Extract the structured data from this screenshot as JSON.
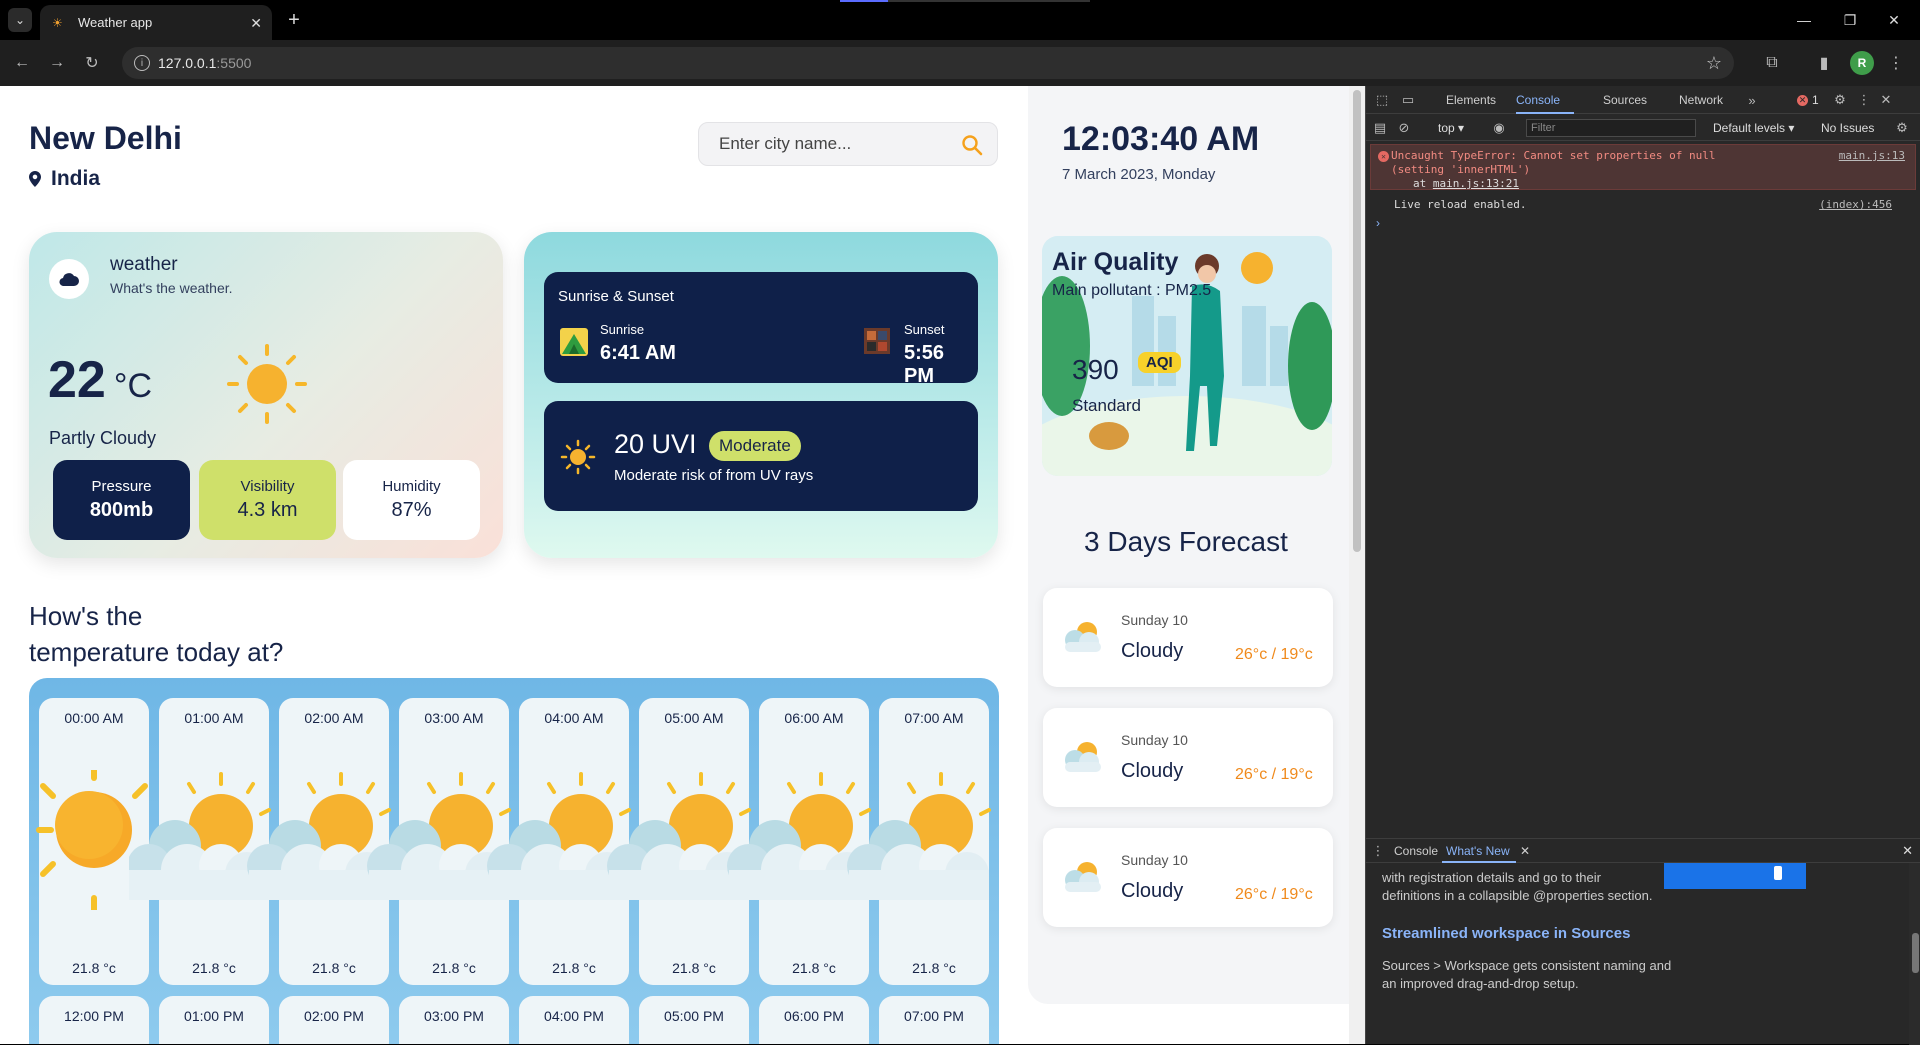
{
  "browser": {
    "tab_title": "Weather app",
    "url_host": "127.0.0.1",
    "url_port": ":5500",
    "profile_initial": "R"
  },
  "header": {
    "city": "New Delhi",
    "country": "India",
    "search_placeholder": "Enter city name..."
  },
  "weather_card": {
    "title": "weather",
    "subtitle": "What's the weather.",
    "temperature": "22",
    "unit": "°C",
    "condition": "Partly Cloudy",
    "pressure_label": "Pressure",
    "pressure_value": "800mb",
    "visibility_label": "Visibility",
    "visibility_value": "4.3 km",
    "humidity_label": "Humidity",
    "humidity_value": "87%"
  },
  "sun_card": {
    "title": "Sunrise & Sunset",
    "sunrise_label": "Sunrise",
    "sunrise_time": "6:41 AM",
    "sunset_label": "Sunset",
    "sunset_time": "5:56 PM",
    "uv_value": "20 UVI",
    "uv_level": "Moderate",
    "uv_desc": "Moderate risk of from UV rays"
  },
  "hourly": {
    "title_line1": "How's the",
    "title_line2": "temperature today at?",
    "items": [
      {
        "time": "00:00 AM",
        "temp": "21.8 °c"
      },
      {
        "time": "01:00 AM",
        "temp": "21.8 °c"
      },
      {
        "time": "02:00 AM",
        "temp": "21.8 °c"
      },
      {
        "time": "03:00 AM",
        "temp": "21.8 °c"
      },
      {
        "time": "04:00 AM",
        "temp": "21.8 °c"
      },
      {
        "time": "05:00 AM",
        "temp": "21.8 °c"
      },
      {
        "time": "06:00 AM",
        "temp": "21.8 °c"
      },
      {
        "time": "07:00 AM",
        "temp": "21.8 °c"
      }
    ],
    "next_row": [
      "12:00 PM",
      "01:00 PM",
      "02:00 PM",
      "03:00 PM",
      "04:00 PM",
      "05:00 PM",
      "06:00 PM",
      "07:00 PM"
    ]
  },
  "sidebar": {
    "time": "12:03:40 AM",
    "date": "7 March 2023, Monday",
    "air_quality": {
      "title": "Air Quality",
      "main_pollutant": "Main pollutant : PM2.5",
      "value": "390",
      "badge": "AQI",
      "level": "Standard"
    },
    "forecast_title": "3 Days Forecast",
    "forecast": [
      {
        "day": "Sunday 10",
        "condition": "Cloudy",
        "temps": "26°c / 19°c"
      },
      {
        "day": "Sunday 10",
        "condition": "Cloudy",
        "temps": "26°c / 19°c"
      },
      {
        "day": "Sunday 10",
        "condition": "Cloudy",
        "temps": "26°c / 19°c"
      }
    ]
  },
  "devtools": {
    "tabs": [
      "Elements",
      "Console",
      "Sources",
      "Network"
    ],
    "error_count": "1",
    "context": "top",
    "filter_placeholder": "Filter",
    "levels": "Default levels",
    "issues": "No Issues",
    "error_message": "Uncaught TypeError: Cannot set properties of null (setting 'innerHTML')",
    "error_at": "at ",
    "error_at_link": "main.js:13:21",
    "error_source": "main.js:13",
    "log_message": "Live reload enabled.",
    "log_source": "(index):456",
    "drawer_tabs": [
      "Console",
      "What's New"
    ],
    "drawer_text1": "with registration details and go to their definitions in a collapsible @properties section.",
    "drawer_link": "Streamlined workspace in Sources",
    "drawer_text2": "Sources > Workspace gets consistent naming and an improved drag-and-drop setup."
  }
}
